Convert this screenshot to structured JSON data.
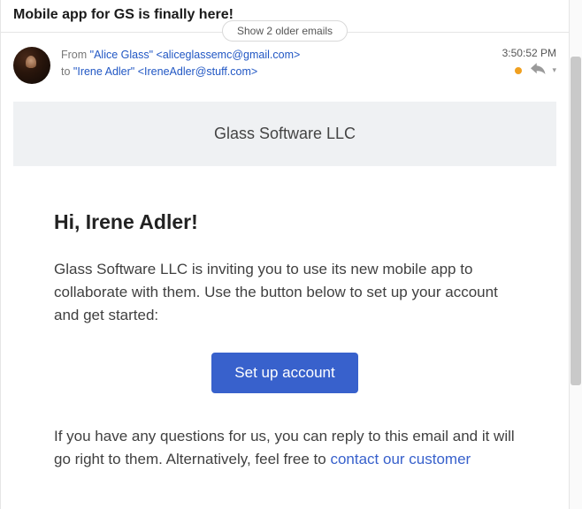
{
  "subject": "Mobile app for GS is finally here!",
  "showOlderLabel": "Show 2 older emails",
  "header": {
    "fromLabel": "From ",
    "fromName": "\"Alice Glass\"",
    "fromEmail": "<aliceglassemc@gmail.com>",
    "toLabel": "to ",
    "toName": "\"Irene Adler\"",
    "toEmail": "<IreneAdler@stuff.com>",
    "time": "3:50:52 PM"
  },
  "body": {
    "brand": "Glass Software LLC",
    "greeting": "Hi, Irene Adler!",
    "intro": "Glass Software LLC is inviting you to use its new mobile app to collaborate with them. Use the button below to set up your account and get started:",
    "cta": "Set up account",
    "followup_prefix": "If you have any questions for us, you can reply to this email and it will go right to them. Alternatively, feel free to ",
    "followup_link": "contact our customer"
  }
}
